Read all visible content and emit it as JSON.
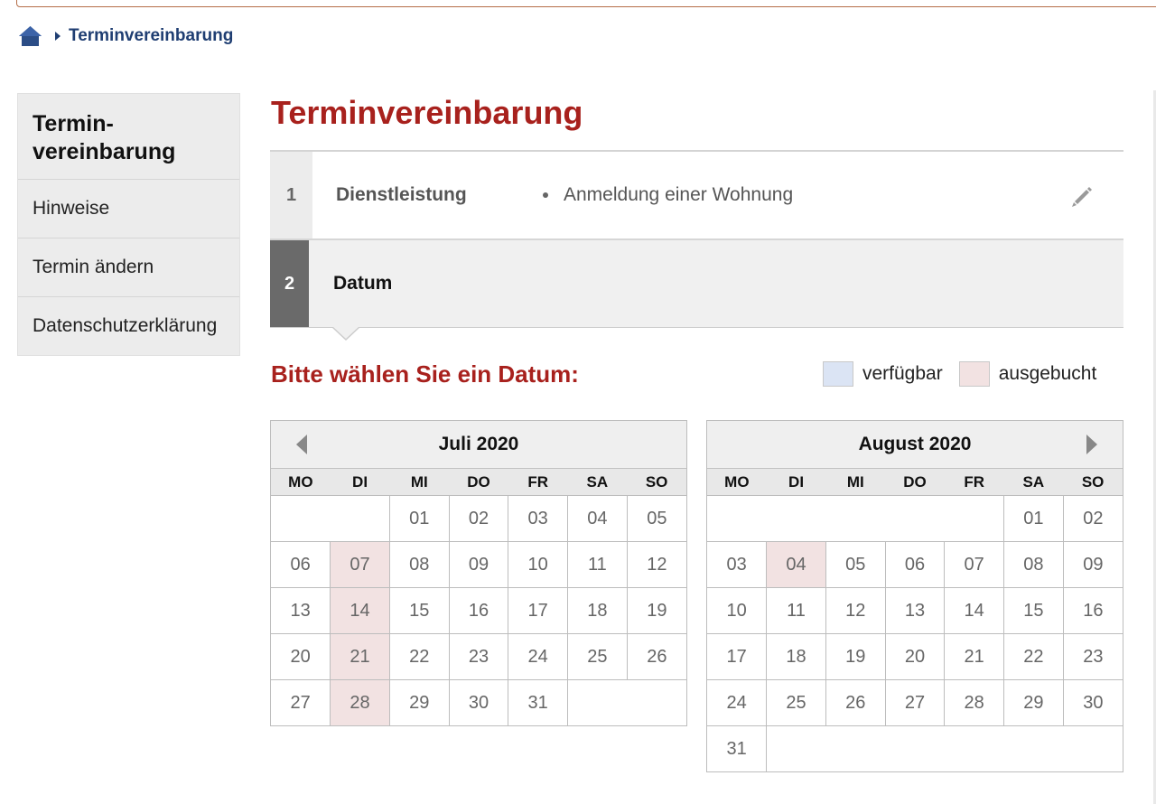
{
  "breadcrumb": {
    "current": "Terminvereinbarung"
  },
  "sidebar": {
    "title": "Termin-\nvereinbarung",
    "items": [
      {
        "label": "Hinweise"
      },
      {
        "label": "Termin ändern"
      },
      {
        "label": "Datenschutzerklärung"
      }
    ]
  },
  "page": {
    "title": "Terminvereinbarung"
  },
  "steps": [
    {
      "number": "1",
      "label": "Dienstleistung",
      "summary": "Anmeldung einer Wohnung"
    },
    {
      "number": "2",
      "label": "Datum"
    }
  ],
  "calendar_section": {
    "heading": "Bitte wählen Sie ein Datum:",
    "legend": {
      "available": "verfügbar",
      "booked": "ausgebucht"
    },
    "weekdays": [
      "MO",
      "DI",
      "MI",
      "DO",
      "FR",
      "SA",
      "SO"
    ],
    "months": [
      {
        "title": "Juli 2020",
        "nav": "prev",
        "weeks": [
          [
            null,
            null,
            "01",
            "02",
            "03",
            "04",
            "05"
          ],
          [
            "06",
            "07",
            "08",
            "09",
            "10",
            "11",
            "12"
          ],
          [
            "13",
            "14",
            "15",
            "16",
            "17",
            "18",
            "19"
          ],
          [
            "20",
            "21",
            "22",
            "23",
            "24",
            "25",
            "26"
          ],
          [
            "27",
            "28",
            "29",
            "30",
            "31",
            null,
            null
          ]
        ],
        "booked": [
          "07",
          "14",
          "21",
          "28"
        ]
      },
      {
        "title": "August 2020",
        "nav": "next",
        "weeks": [
          [
            null,
            null,
            null,
            null,
            null,
            "01",
            "02"
          ],
          [
            "03",
            "04",
            "05",
            "06",
            "07",
            "08",
            "09"
          ],
          [
            "10",
            "11",
            "12",
            "13",
            "14",
            "15",
            "16"
          ],
          [
            "17",
            "18",
            "19",
            "20",
            "21",
            "22",
            "23"
          ],
          [
            "24",
            "25",
            "26",
            "27",
            "28",
            "29",
            "30"
          ],
          [
            "31",
            null,
            null,
            null,
            null,
            null,
            null
          ]
        ],
        "booked": [
          "04"
        ]
      }
    ]
  },
  "colors": {
    "accent_red": "#a8211d",
    "link_blue": "#1f3e72",
    "available": "#dbe4f4",
    "booked": "#f2e2e2"
  }
}
